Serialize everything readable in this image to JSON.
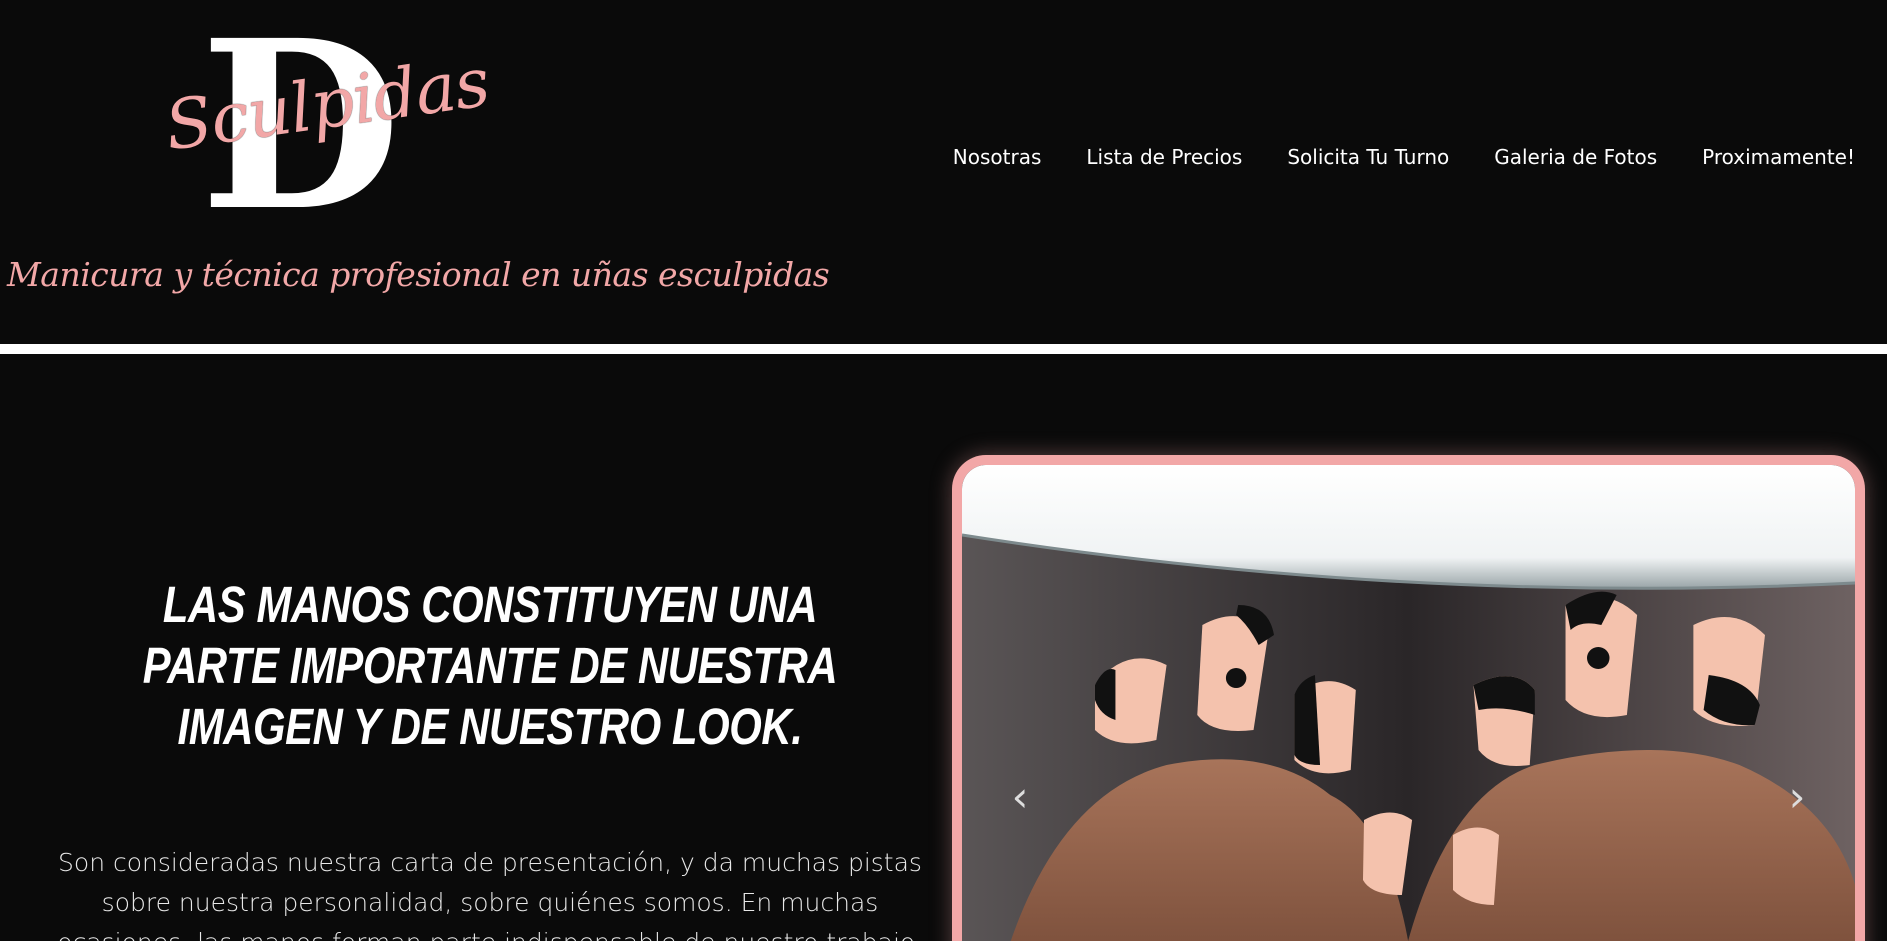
{
  "brand": {
    "logo_letter": "D",
    "logo_script": "Sculpidas",
    "tagline": "Manicura y técnica profesional en uñas esculpidas",
    "accent_color": "#f2a7a7"
  },
  "nav": {
    "items": [
      {
        "label": "Nosotras"
      },
      {
        "label": "Lista de Precios"
      },
      {
        "label": "Solicita Tu Turno"
      },
      {
        "label": "Galeria de Fotos"
      },
      {
        "label": "Proximamente!"
      }
    ]
  },
  "hero": {
    "headline": "LAS MANOS CONSTITUYEN UNA PARTE IMPORTANTE DE NUESTRA IMAGEN Y DE NUESTRO LOOK.",
    "body": "Son consideradas nuestra carta de presentación, y da muchas pistas sobre nuestra personalidad, sobre quiénes somos. En muchas ocasiones, las manos forman parte indispensable de nuestro trabajo."
  },
  "slider": {
    "prev_icon": "chevron-left-icon",
    "next_icon": "chevron-right-icon",
    "prev_glyph": "‹",
    "next_glyph": "›"
  }
}
